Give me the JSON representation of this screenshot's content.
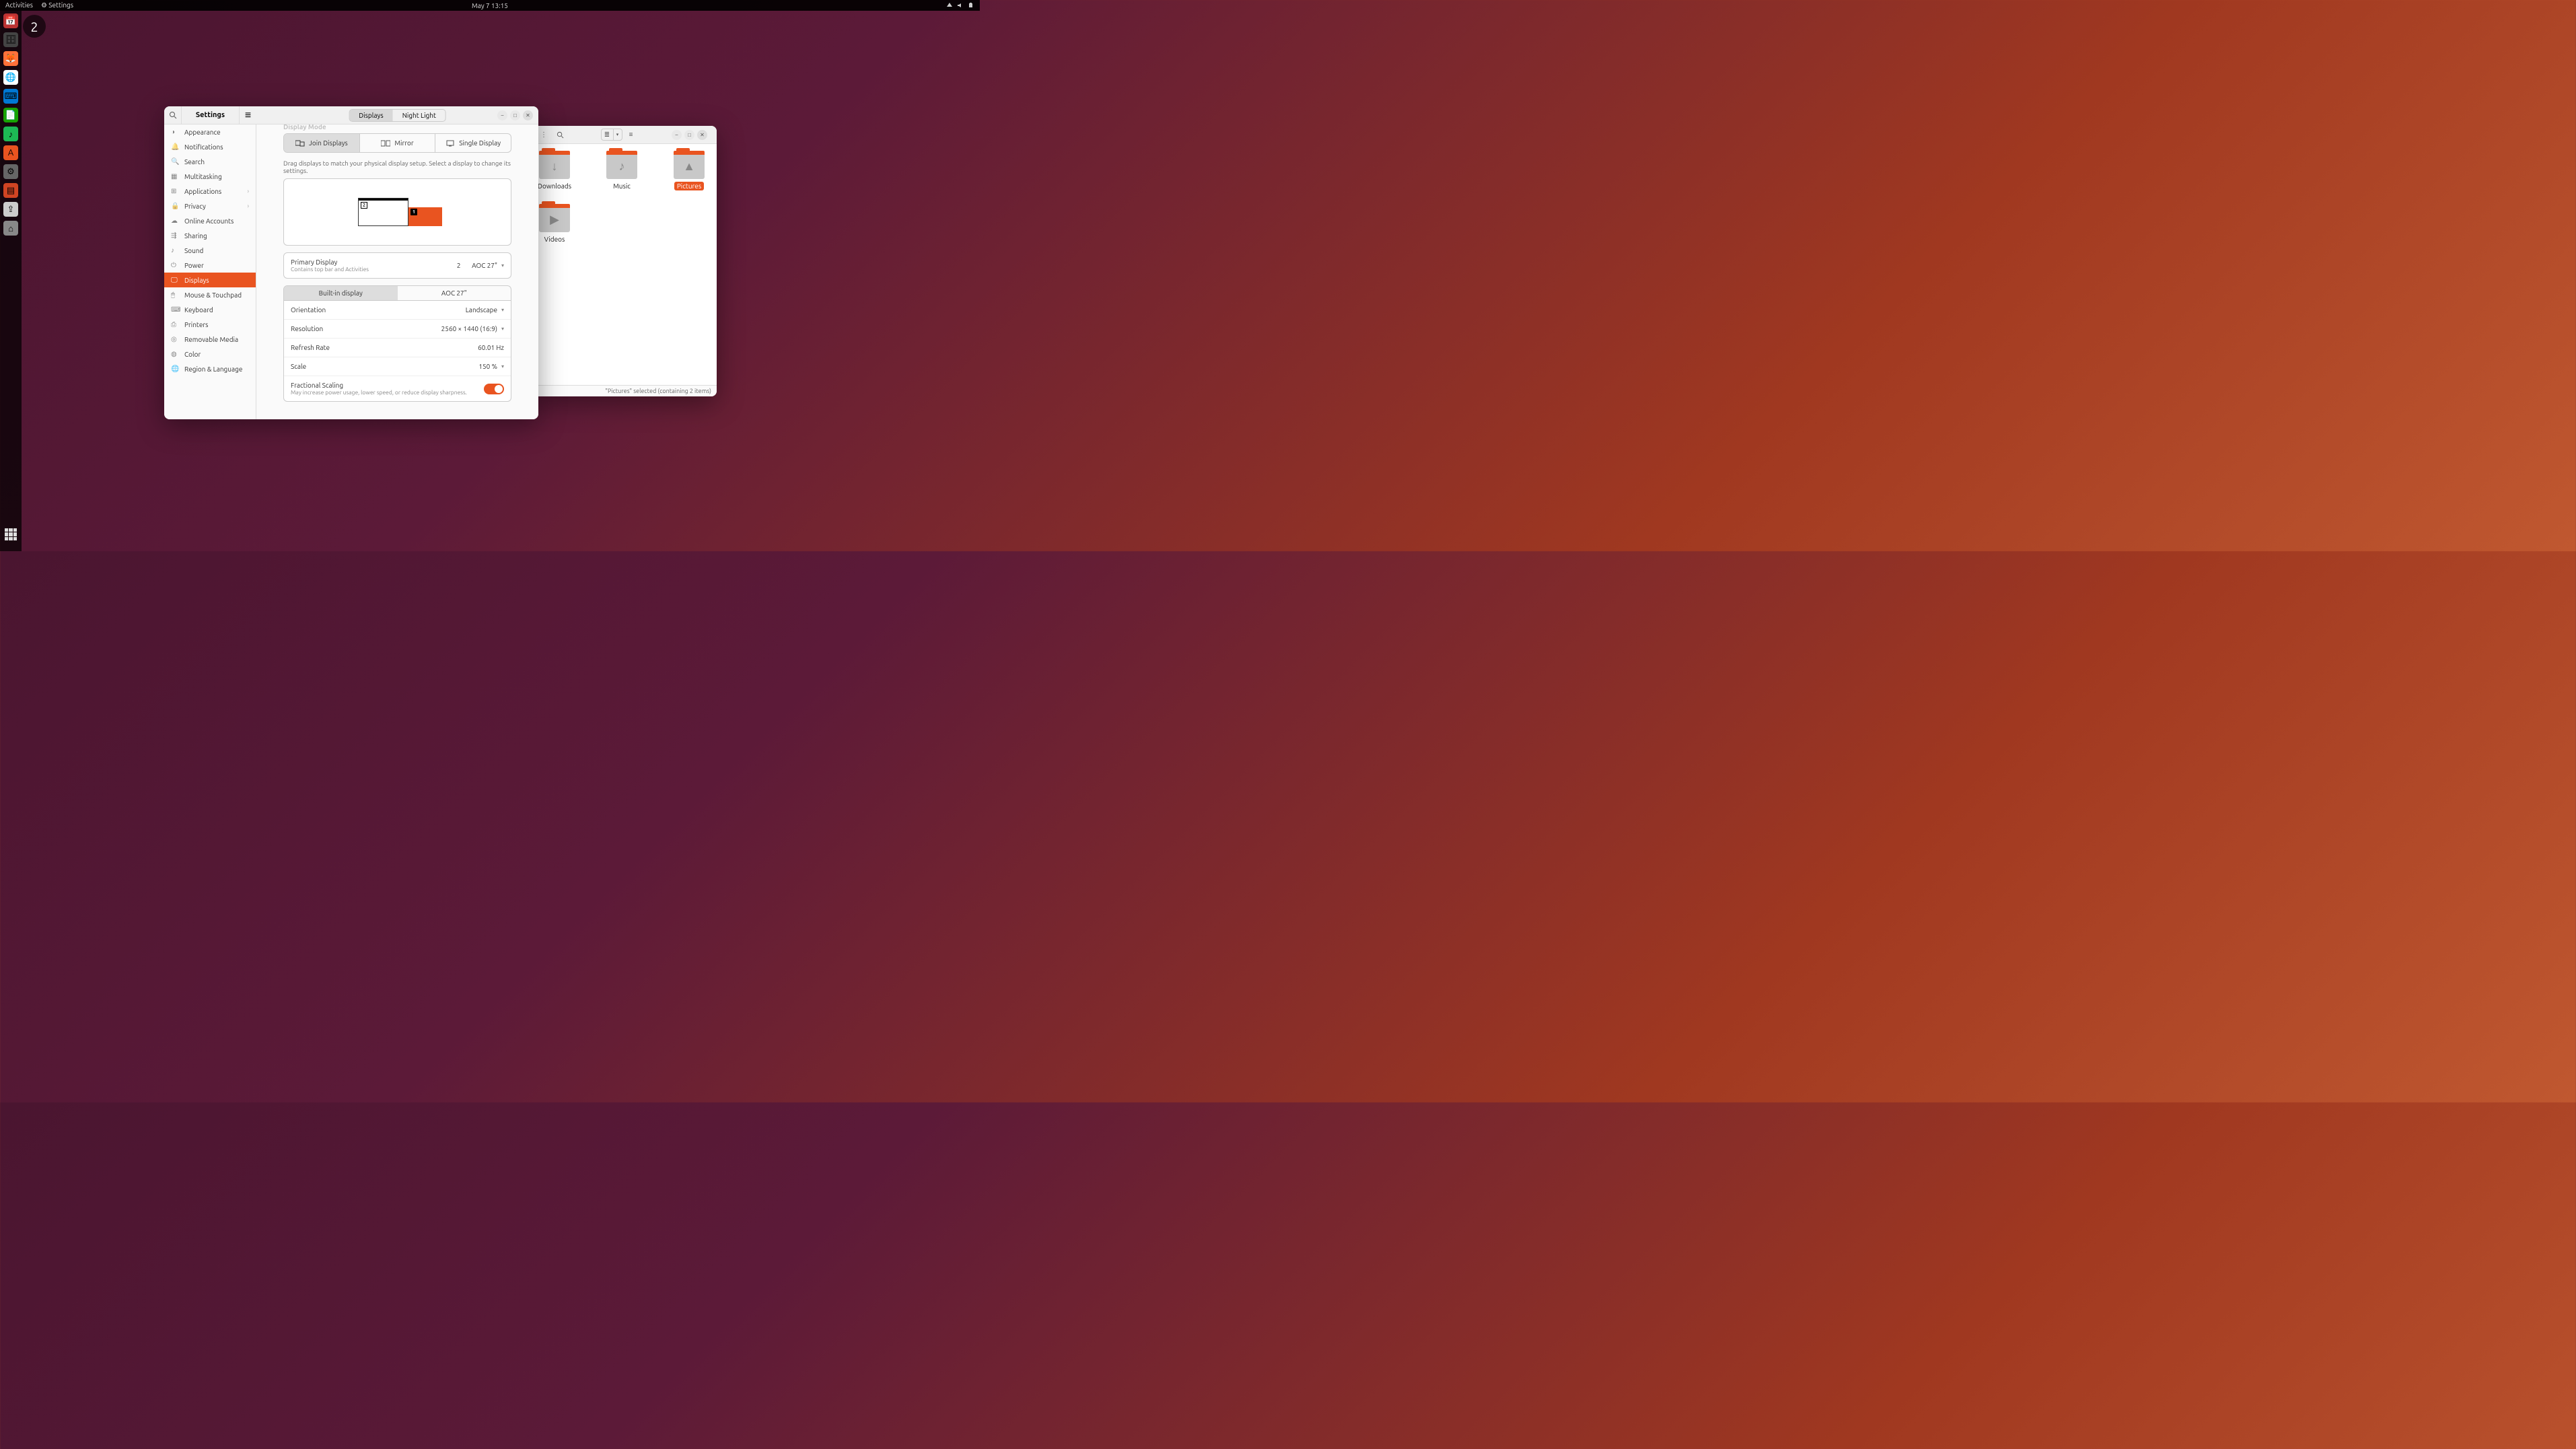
{
  "topbar": {
    "activities": "Activities",
    "app_icon": "⚙",
    "app_name": "Settings",
    "datetime": "May 7  13:15"
  },
  "badge_monitor": "2",
  "dock": [
    {
      "name": "calendar",
      "bg": "#b33",
      "glyph": "📅"
    },
    {
      "name": "files",
      "bg": "#444",
      "glyph": "🗄"
    },
    {
      "name": "firefox",
      "bg": "#ff7139",
      "glyph": "🦊"
    },
    {
      "name": "chrome",
      "bg": "#fff",
      "glyph": "🌐"
    },
    {
      "name": "vscode",
      "bg": "#0078d4",
      "glyph": "⌨"
    },
    {
      "name": "libreoffice",
      "bg": "#18a303",
      "glyph": "📄"
    },
    {
      "name": "spotify",
      "bg": "#1db954",
      "glyph": "♪"
    },
    {
      "name": "software",
      "bg": "#e95420",
      "glyph": "A"
    },
    {
      "name": "settings",
      "bg": "#666",
      "glyph": "⚙"
    },
    {
      "name": "slides",
      "bg": "#d04423",
      "glyph": "▤"
    },
    {
      "name": "usb",
      "bg": "#ccc",
      "glyph": "⇪"
    },
    {
      "name": "drive",
      "bg": "#888",
      "glyph": "⌂"
    }
  ],
  "settings": {
    "title": "Settings",
    "tabs": {
      "displays": "Displays",
      "night": "Night Light"
    },
    "sidebar": [
      {
        "icon": "appearance",
        "label": "Appearance"
      },
      {
        "icon": "bell",
        "label": "Notifications"
      },
      {
        "icon": "search",
        "label": "Search"
      },
      {
        "icon": "multi",
        "label": "Multitasking"
      },
      {
        "icon": "apps",
        "label": "Applications",
        "arrow": true
      },
      {
        "icon": "lock",
        "label": "Privacy",
        "arrow": true
      },
      {
        "icon": "cloud",
        "label": "Online Accounts"
      },
      {
        "icon": "share",
        "label": "Sharing"
      },
      {
        "icon": "sound",
        "label": "Sound"
      },
      {
        "icon": "power",
        "label": "Power"
      },
      {
        "icon": "display",
        "label": "Displays",
        "on": true
      },
      {
        "icon": "mouse",
        "label": "Mouse & Touchpad"
      },
      {
        "icon": "keyboard",
        "label": "Keyboard"
      },
      {
        "icon": "printer",
        "label": "Printers"
      },
      {
        "icon": "disc",
        "label": "Removable Media"
      },
      {
        "icon": "color",
        "label": "Color"
      },
      {
        "icon": "globe",
        "label": "Region & Language"
      }
    ],
    "pane": {
      "section_label": "Display Mode",
      "modes": {
        "join": "Join Displays",
        "mirror": "Mirror",
        "single": "Single Display"
      },
      "hint": "Drag displays to match your physical display setup. Select a display to change its settings.",
      "arr_mon2": "2",
      "arr_mon1": "1",
      "primary": {
        "label": "Primary Display",
        "sub": "Contains top bar and Activities",
        "value_num": "2",
        "value_name": "AOC 27\""
      },
      "disp_tabs": {
        "a": "Built-in display",
        "b": "AOC 27\""
      },
      "rows": {
        "orientation_l": "Orientation",
        "orientation_v": "Landscape",
        "resolution_l": "Resolution",
        "resolution_v": "2560 × 1440 (16:9)",
        "refresh_l": "Refresh Rate",
        "refresh_v": "60.01 Hz",
        "scale_l": "Scale",
        "scale_v": "150 %",
        "frac_l": "Fractional Scaling",
        "frac_sub": "May increase power usage, lower speed, or reduce display sharpness."
      }
    }
  },
  "files": {
    "folders": [
      {
        "label": "Downloads",
        "glyph": "↓"
      },
      {
        "label": "Music",
        "glyph": "♪"
      },
      {
        "label": "Pictures",
        "glyph": "▲",
        "sel": true
      },
      {
        "label": "Videos",
        "glyph": "▶"
      }
    ],
    "status": "\"Pictures\" selected  (containing 2 items)"
  }
}
